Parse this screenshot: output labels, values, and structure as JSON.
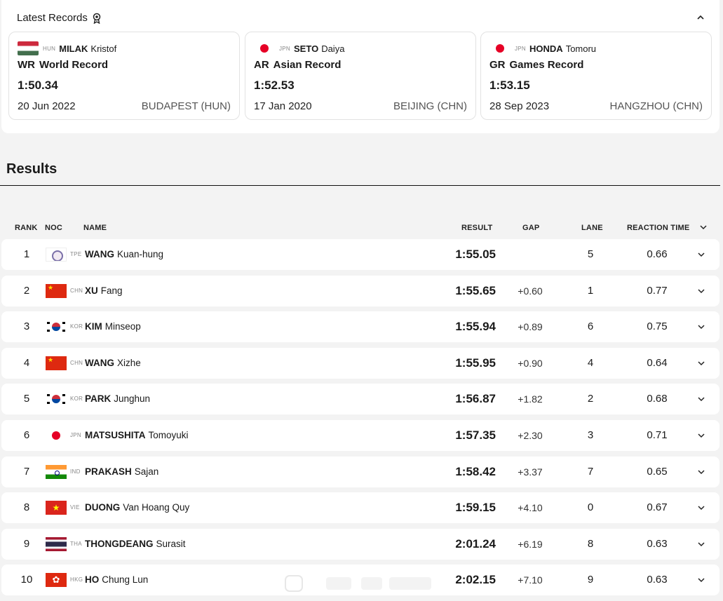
{
  "latest_records": {
    "title": "Latest Records",
    "cards": [
      {
        "flag": "hun",
        "noc": "HUN",
        "surname": "MILAK",
        "given": "Kristof",
        "abbr": "WR",
        "type": "World Record",
        "time": "1:50.34",
        "date": "20 Jun 2022",
        "venue": "BUDAPEST (HUN)"
      },
      {
        "flag": "jpn",
        "noc": "JPN",
        "surname": "SETO",
        "given": "Daiya",
        "abbr": "AR",
        "type": "Asian Record",
        "time": "1:52.53",
        "date": "17 Jan 2020",
        "venue": "BEIJING (CHN)"
      },
      {
        "flag": "jpn",
        "noc": "JPN",
        "surname": "HONDA",
        "given": "Tomoru",
        "abbr": "GR",
        "type": "Games Record",
        "time": "1:53.15",
        "date": "28 Sep 2023",
        "venue": "HANGZHOU (CHN)"
      }
    ]
  },
  "results": {
    "title": "Results",
    "columns": {
      "rank": "RANK",
      "noc": "NOC",
      "name": "NAME",
      "result": "RESULT",
      "gap": "GAP",
      "lane": "LANE",
      "reaction": "REACTION TIME"
    },
    "rows": [
      {
        "rank": "1",
        "flag": "tpe",
        "noc": "TPE",
        "surname": "WANG",
        "given": "Kuan-hung",
        "result": "1:55.05",
        "gap": "",
        "lane": "5",
        "reaction": "0.66"
      },
      {
        "rank": "2",
        "flag": "chn",
        "noc": "CHN",
        "surname": "XU",
        "given": "Fang",
        "result": "1:55.65",
        "gap": "+0.60",
        "lane": "1",
        "reaction": "0.77"
      },
      {
        "rank": "3",
        "flag": "kor",
        "noc": "KOR",
        "surname": "KIM",
        "given": "Minseop",
        "result": "1:55.94",
        "gap": "+0.89",
        "lane": "6",
        "reaction": "0.75"
      },
      {
        "rank": "4",
        "flag": "chn",
        "noc": "CHN",
        "surname": "WANG",
        "given": "Xizhe",
        "result": "1:55.95",
        "gap": "+0.90",
        "lane": "4",
        "reaction": "0.64"
      },
      {
        "rank": "5",
        "flag": "kor",
        "noc": "KOR",
        "surname": "PARK",
        "given": "Junghun",
        "result": "1:56.87",
        "gap": "+1.82",
        "lane": "2",
        "reaction": "0.68"
      },
      {
        "rank": "6",
        "flag": "jpn",
        "noc": "JPN",
        "surname": "MATSUSHITA",
        "given": "Tomoyuki",
        "result": "1:57.35",
        "gap": "+2.30",
        "lane": "3",
        "reaction": "0.71"
      },
      {
        "rank": "7",
        "flag": "ind",
        "noc": "IND",
        "surname": "PRAKASH",
        "given": "Sajan",
        "result": "1:58.42",
        "gap": "+3.37",
        "lane": "7",
        "reaction": "0.65"
      },
      {
        "rank": "8",
        "flag": "vie",
        "noc": "VIE",
        "surname": "DUONG",
        "given": "Van Hoang Quy",
        "result": "1:59.15",
        "gap": "+4.10",
        "lane": "0",
        "reaction": "0.67"
      },
      {
        "rank": "9",
        "flag": "tha",
        "noc": "THA",
        "surname": "THONGDEANG",
        "given": "Surasit",
        "result": "2:01.24",
        "gap": "+6.19",
        "lane": "8",
        "reaction": "0.63"
      },
      {
        "rank": "10",
        "flag": "hkg",
        "noc": "HKG",
        "surname": "HO",
        "given": "Chung Lun",
        "result": "2:02.15",
        "gap": "+7.10",
        "lane": "9",
        "reaction": "0.63"
      }
    ]
  },
  "icons": {
    "award": "award-ribbon-icon",
    "collapse": "chevron-up-icon",
    "expand": "chevron-down-icon"
  }
}
